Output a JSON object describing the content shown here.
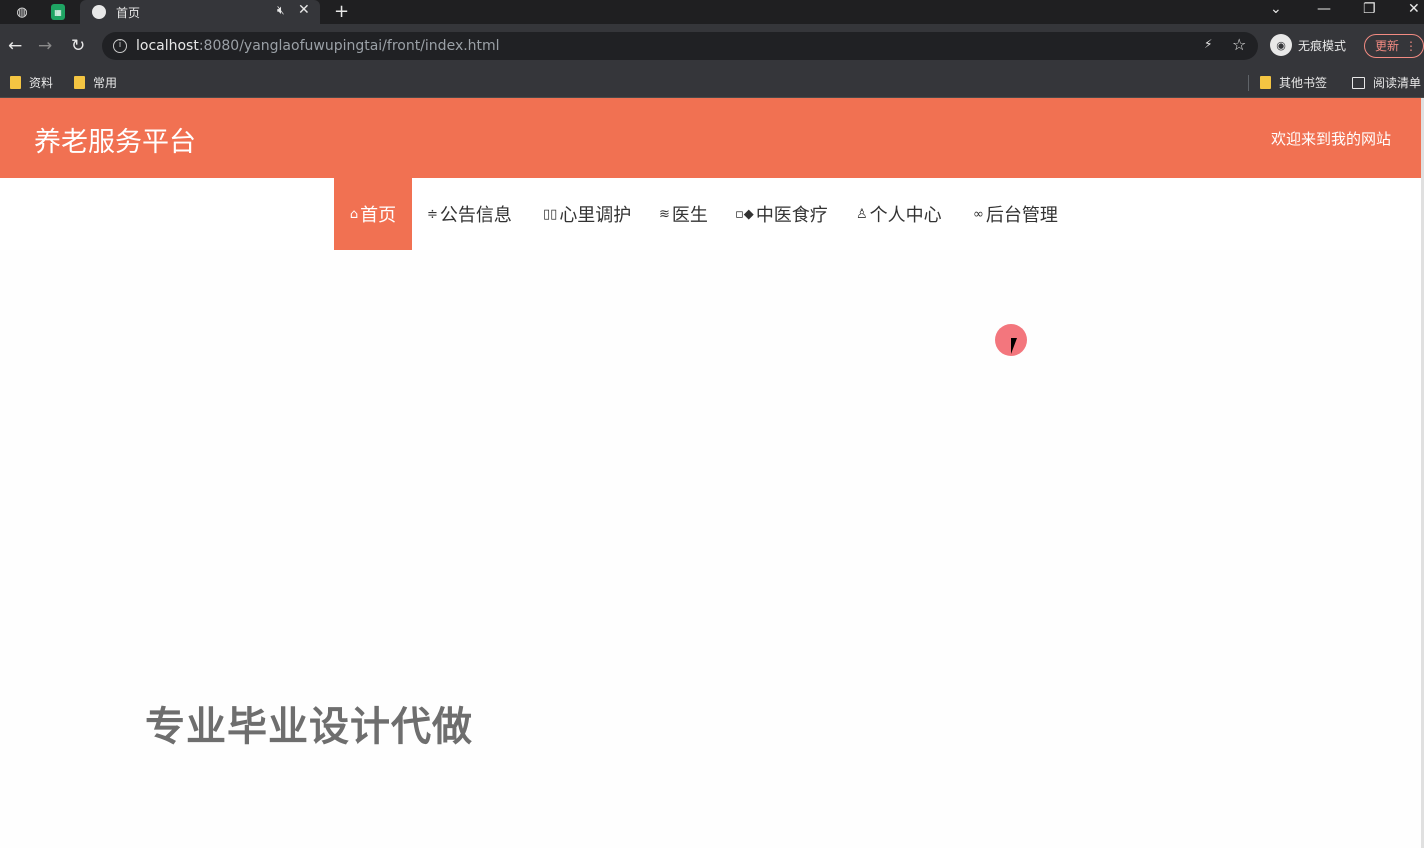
{
  "browser": {
    "tab_title": "首页",
    "url_host": "localhost",
    "url_rest": ":8080/yanglaofuwupingtai/front/index.html",
    "incognito_label": "无痕模式",
    "update_label": "更新",
    "bookmarks": {
      "left": [
        "资料",
        "常用"
      ],
      "other": "其他书签",
      "reading_list": "阅读清单"
    }
  },
  "site": {
    "title": "养老服务平台",
    "welcome": "欢迎来到我的网站"
  },
  "nav": [
    {
      "label": "首页",
      "icon": "home-icon",
      "glyph": "⌂",
      "active": true
    },
    {
      "label": "公告信息",
      "icon": "sliders-icon",
      "glyph": "≑",
      "active": false
    },
    {
      "label": "心里调护",
      "icon": "columns-icon",
      "glyph": "▯▯",
      "active": false
    },
    {
      "label": "医生",
      "icon": "layers-icon",
      "glyph": "≋",
      "active": false
    },
    {
      "label": "中医食疗",
      "icon": "grid-icon",
      "glyph": "▫◆",
      "active": false
    },
    {
      "label": "个人中心",
      "icon": "user-icon",
      "glyph": "♙",
      "active": false
    },
    {
      "label": "后台管理",
      "icon": "link-icon",
      "glyph": "∞",
      "active": false
    }
  ],
  "banner": {
    "text": "专业毕业设计代做"
  },
  "colors": {
    "accent": "#f17152",
    "chrome_dark": "#35363a"
  }
}
